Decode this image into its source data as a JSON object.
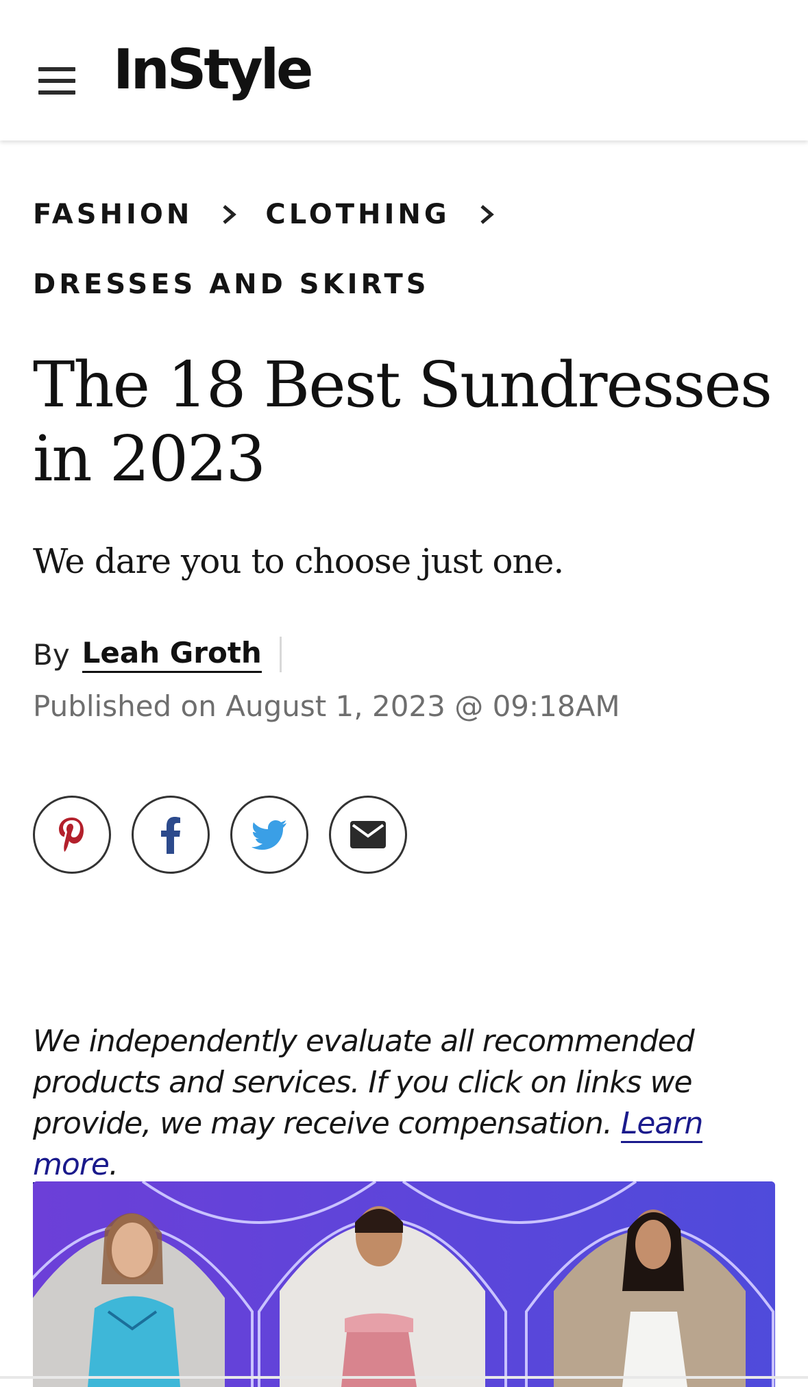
{
  "header": {
    "menu_icon": "hamburger-menu-icon",
    "logo_text": "InStyle"
  },
  "breadcrumb": {
    "items": [
      "FASHION",
      "CLOTHING",
      "DRESSES AND SKIRTS"
    ]
  },
  "article": {
    "title": "The 18 Best Sundresses in 2023",
    "dek": "We dare you to choose just one.",
    "by_label": "By",
    "author": "Leah Groth",
    "published": "Published on August 1, 2023 @ 09:18AM"
  },
  "share": {
    "pinterest_icon": "pinterest-icon",
    "facebook_icon": "facebook-icon",
    "twitter_icon": "twitter-icon",
    "email_icon": "email-icon",
    "colors": {
      "pinterest": "#b3202b",
      "facebook": "#2c4a8c",
      "twitter": "#3a9fe6",
      "email": "#2a2a2a"
    }
  },
  "disclaimer": {
    "text": "We independently evaluate all recommended products and services. If you click on links we provide, we may receive compensation.",
    "link_label": "Learn more",
    "suffix": "."
  },
  "hero": {
    "description_icon": "product-collage-image",
    "accent": "#5a46d6"
  }
}
